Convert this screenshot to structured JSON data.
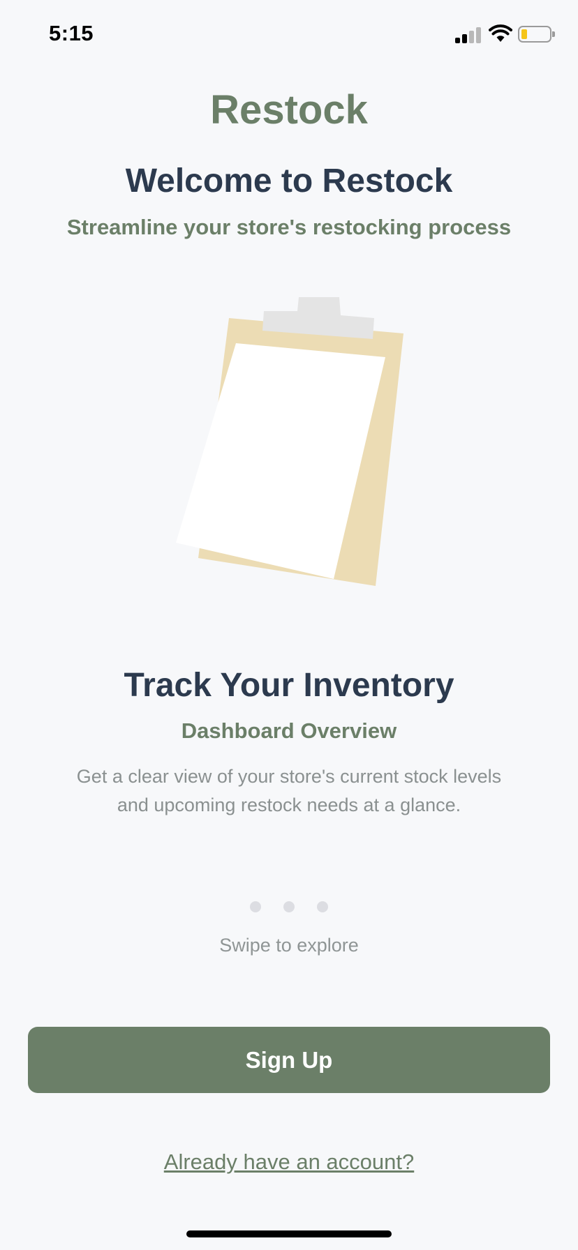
{
  "status_bar": {
    "time": "5:15",
    "icons": [
      "cellular-signal-icon",
      "wifi-icon",
      "battery-icon"
    ],
    "battery_level": 0.2
  },
  "brand": {
    "name": "Restock"
  },
  "header": {
    "title": "Welcome to Restock",
    "tagline": "Streamline your store's restocking process"
  },
  "slide": {
    "illustration_icon": "clipboard-icon",
    "title": "Track Your Inventory",
    "subtitle": "Dashboard Overview",
    "description": "Get a clear view of your store's current stock levels and upcoming restock needs at a glance."
  },
  "pagination": {
    "count": 3,
    "hint": "Swipe to explore"
  },
  "actions": {
    "signup_label": "Sign Up",
    "signin_link": "Already have an account?"
  },
  "colors": {
    "background": "#f7f8fa",
    "brand_green": "#6b7f68",
    "heading_navy": "#2c3a4e",
    "body_gray": "#8a9090",
    "clipboard_board": "#ecdcb4",
    "clipboard_clip": "#e4e4e4",
    "battery_fill": "#f5c518"
  }
}
